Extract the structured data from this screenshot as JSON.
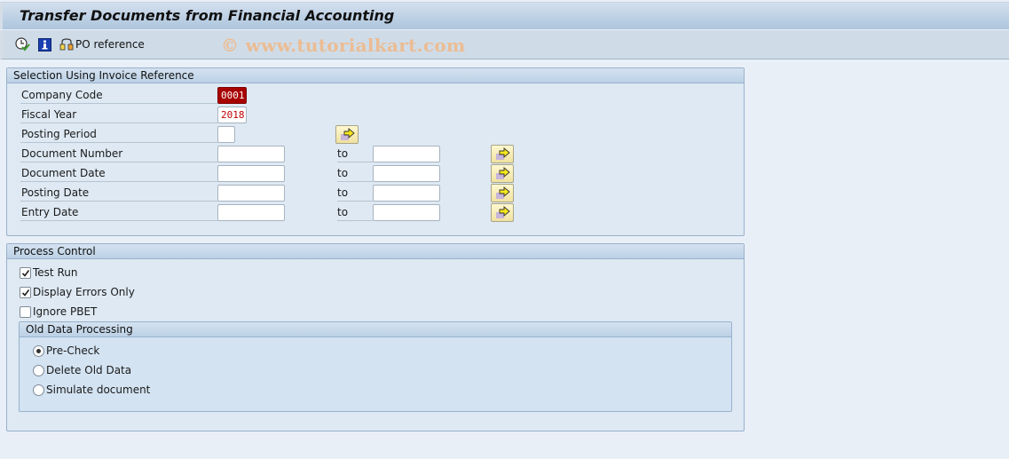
{
  "window": {
    "title": "Transfer Documents from Financial Accounting"
  },
  "toolbar": {
    "execute_icon": "clock-check-icon",
    "info_icon": "info-icon",
    "po_reference_icon": "hierarchy-icon",
    "po_reference_label": "PO reference"
  },
  "watermark": "© www.tutorialkart.com",
  "selection": {
    "title": "Selection Using Invoice Reference",
    "company_code": {
      "label": "Company Code",
      "value": "0001"
    },
    "fiscal_year": {
      "label": "Fiscal Year",
      "value": "2018"
    },
    "posting_period": {
      "label": "Posting Period",
      "value": ""
    },
    "to_label": "to",
    "ranges": [
      {
        "label": "Document Number",
        "from": "",
        "to": ""
      },
      {
        "label": "Document Date",
        "from": "",
        "to": ""
      },
      {
        "label": "Posting Date",
        "from": "",
        "to": ""
      },
      {
        "label": "Entry Date",
        "from": "",
        "to": ""
      }
    ]
  },
  "process_control": {
    "title": "Process Control",
    "checkboxes": [
      {
        "label": "Test Run",
        "checked": true
      },
      {
        "label": "Display Errors Only",
        "checked": true
      },
      {
        "label": "Ignore PBET",
        "checked": false
      }
    ],
    "old_data": {
      "title": "Old Data Processing",
      "options": [
        {
          "label": "Pre-Check",
          "selected": true
        },
        {
          "label": "Delete Old Data",
          "selected": false
        },
        {
          "label": "Simulate document",
          "selected": false
        }
      ]
    }
  },
  "colors": {
    "required_field_bg": "#a80000",
    "value_text": "#c00000",
    "watermark": "#f0b98a"
  }
}
